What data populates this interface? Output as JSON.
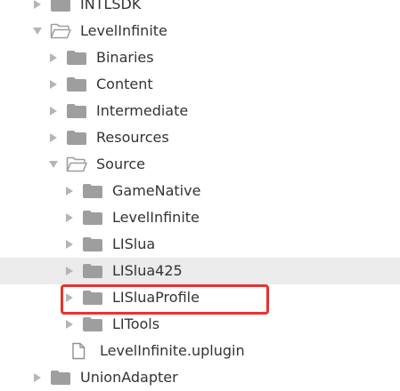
{
  "tree": {
    "highlight_color": "#e8322f",
    "row_highlight_color": "#ebebeb",
    "items": [
      {
        "label": "INTLSDK",
        "type": "folder",
        "expanded": false,
        "depth": 0
      },
      {
        "label": "LevelInfinite",
        "type": "folder",
        "expanded": true,
        "depth": 0
      },
      {
        "label": "Binaries",
        "type": "folder",
        "expanded": false,
        "depth": 1
      },
      {
        "label": "Content",
        "type": "folder",
        "expanded": false,
        "depth": 1
      },
      {
        "label": "Intermediate",
        "type": "folder",
        "expanded": false,
        "depth": 1
      },
      {
        "label": "Resources",
        "type": "folder",
        "expanded": false,
        "depth": 1
      },
      {
        "label": "Source",
        "type": "folder",
        "expanded": true,
        "depth": 1
      },
      {
        "label": "GameNative",
        "type": "folder",
        "expanded": false,
        "depth": 2
      },
      {
        "label": "LevelInfinite",
        "type": "folder",
        "expanded": false,
        "depth": 2
      },
      {
        "label": "LISlua",
        "type": "folder",
        "expanded": false,
        "depth": 2
      },
      {
        "label": "LISlua425",
        "type": "folder",
        "expanded": false,
        "depth": 2,
        "hovered": true
      },
      {
        "label": "LISluaProfile",
        "type": "folder",
        "expanded": false,
        "depth": 2,
        "annotated": true
      },
      {
        "label": "LITools",
        "type": "folder",
        "expanded": false,
        "depth": 2
      },
      {
        "label": "LevelInfinite.uplugin",
        "type": "file",
        "depth": 1
      },
      {
        "label": "UnionAdapter",
        "type": "folder",
        "expanded": false,
        "depth": 0
      }
    ]
  }
}
